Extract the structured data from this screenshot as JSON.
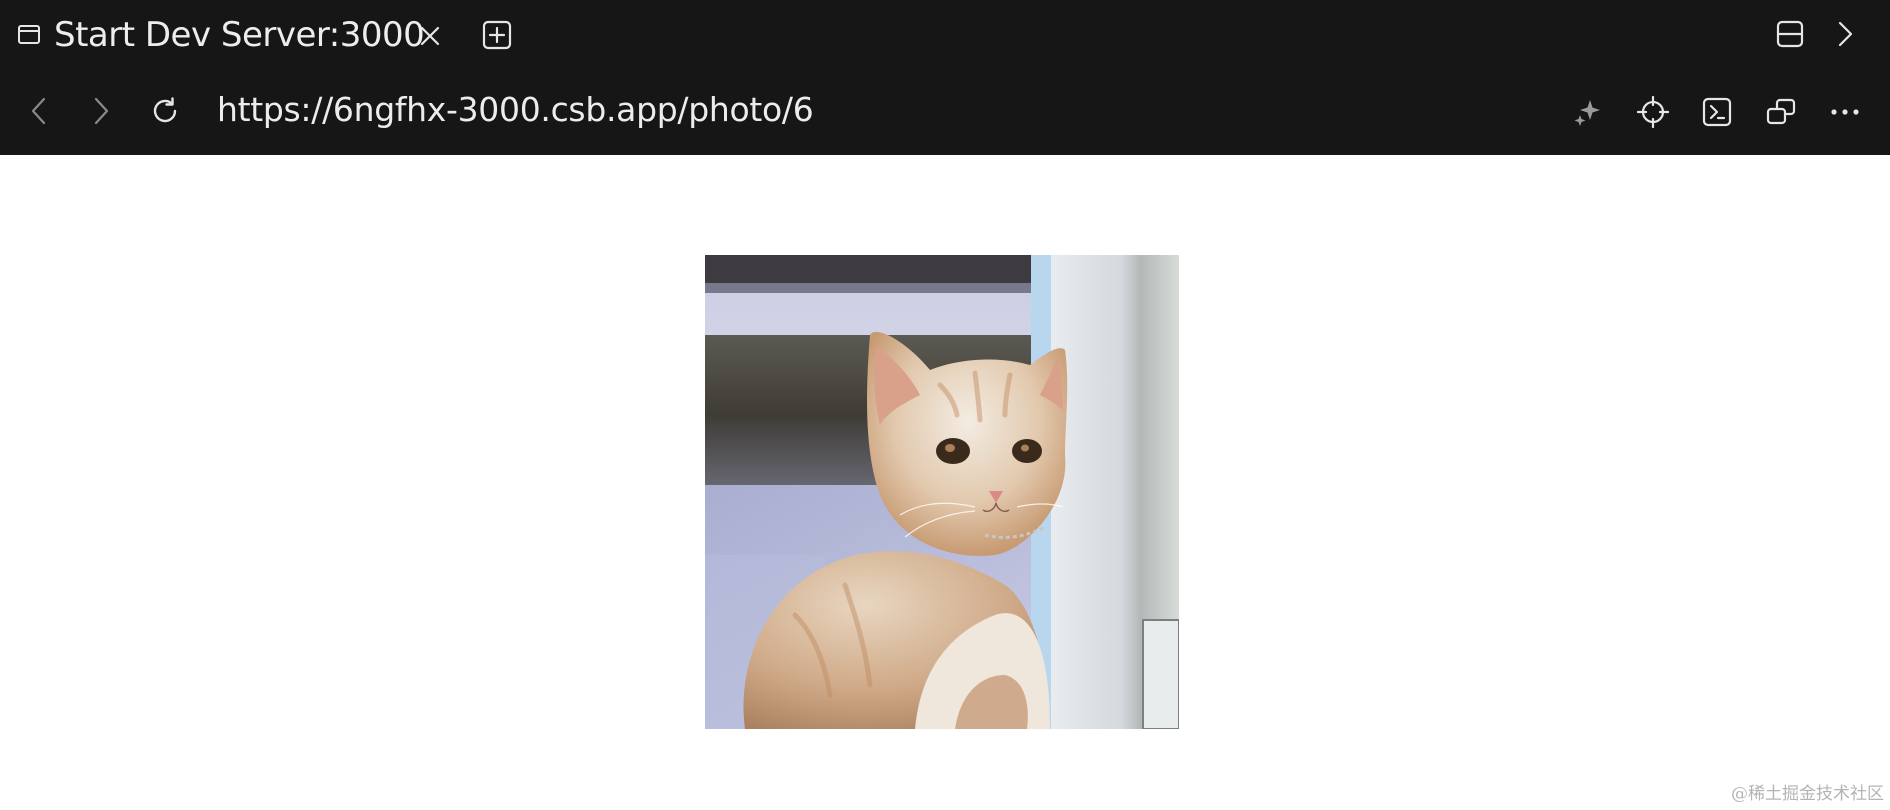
{
  "tab": {
    "title": "Start Dev Server:3000",
    "icon": "browser-window-icon"
  },
  "address_bar": {
    "url": "https://6ngfhx-3000.csb.app/photo/6"
  },
  "toolbar": {
    "icons": [
      "back-arrow-icon",
      "forward-arrow-icon",
      "reload-icon",
      "sparkle-icon",
      "crosshair-icon",
      "terminal-icon",
      "windows-icon",
      "more-icon"
    ]
  },
  "content": {
    "image_subject": "cat-photo"
  },
  "watermark": {
    "text": "@稀土掘金技术社区"
  },
  "colors": {
    "chrome_bg": "#161616",
    "chrome_text": "#ececec",
    "page_bg": "#ffffff"
  }
}
